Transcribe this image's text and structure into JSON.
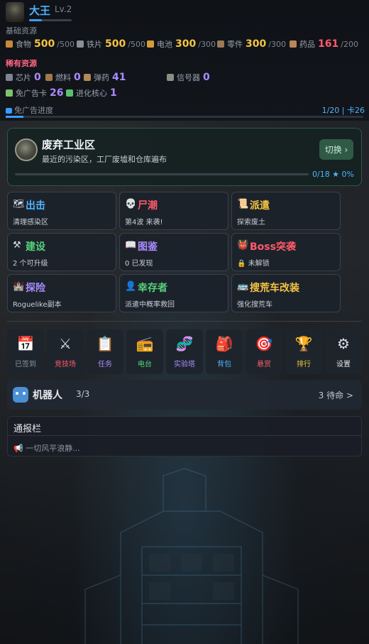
{
  "player": {
    "name": "大王",
    "level": "Lv.2",
    "xp_fraction": 0.3
  },
  "basic_resources": {
    "label": "基础资源",
    "items": [
      {
        "label": "食物",
        "value": "500",
        "max": "/500",
        "color": "gold",
        "icon": "food-icon"
      },
      {
        "label": "铁片",
        "value": "500",
        "max": "/500",
        "color": "gold",
        "icon": "iron-icon"
      },
      {
        "label": "电池",
        "value": "300",
        "max": "/300",
        "color": "gold",
        "icon": "battery-icon"
      },
      {
        "label": "零件",
        "value": "300",
        "max": "/300",
        "color": "gold",
        "icon": "parts-icon"
      },
      {
        "label": "药品",
        "value": "161",
        "max": "/200",
        "color": "red",
        "icon": "medicine-icon"
      }
    ]
  },
  "rare_resources": {
    "label": "稀有资源",
    "items": [
      {
        "label": "芯片",
        "value": "0"
      },
      {
        "label": "燃料",
        "value": "0"
      },
      {
        "label": "弹药",
        "value": "41"
      },
      {
        "label": "信号器",
        "value": "0"
      }
    ],
    "items2": [
      {
        "label": "免广告卡",
        "value": "26"
      },
      {
        "label": "进化核心",
        "value": "1"
      }
    ]
  },
  "ad_progress": {
    "label": "免广告进度",
    "value": "1/20 | 卡26",
    "fraction": 0.05
  },
  "area": {
    "title": "废弃工业区",
    "subtitle": "最近的污染区，工厂废墟和仓库遍布",
    "switch_label": "切换 ›",
    "progress": "0/18 ★  0%",
    "fraction": 0
  },
  "tiles": [
    {
      "icon": "🗺",
      "title": "出击",
      "sub": "清理感染区",
      "color": "#4fb3ff",
      "name": "attack"
    },
    {
      "icon": "💀",
      "title": "尸潮",
      "sub": "第4波 来袭!",
      "color": "#ff5a6a",
      "name": "zombie-wave"
    },
    {
      "icon": "📜",
      "title": "派遣",
      "sub": "探索废土",
      "color": "#f5c442",
      "name": "dispatch"
    },
    {
      "icon": "⚒",
      "title": "建设",
      "sub": "2 个可升级",
      "color": "#55d27a",
      "name": "build"
    },
    {
      "icon": "📖",
      "title": "图鉴",
      "sub": "0 已发现",
      "color": "#a98cff",
      "name": "codex"
    },
    {
      "icon": "👹",
      "title": "Boss突袭",
      "sub": "🔒 未解锁",
      "color": "#ff5a6a",
      "name": "boss-raid"
    },
    {
      "icon": "🏰",
      "title": "探险",
      "sub": "Roguelike副本",
      "color": "#a98cff",
      "name": "adventure"
    },
    {
      "icon": "👤",
      "title": "幸存者",
      "sub": "派遣中概率救回",
      "color": "#55d27a",
      "name": "survivors"
    },
    {
      "icon": "🚌",
      "title": "搜荒车改装",
      "sub": "强化搜荒车",
      "color": "#f5c442",
      "name": "vehicle-mod"
    }
  ],
  "icon_bar": [
    {
      "glyph": "📅",
      "label": "已签到",
      "color": "#8d949e",
      "name": "checkin"
    },
    {
      "glyph": "⚔",
      "label": "竞技场",
      "color": "#ff5a6a",
      "name": "arena"
    },
    {
      "glyph": "📋",
      "label": "任务",
      "color": "#a98cff",
      "name": "tasks"
    },
    {
      "glyph": "📻",
      "label": "电台",
      "color": "#55d27a",
      "name": "radio"
    },
    {
      "glyph": "🧬",
      "label": "实验塔",
      "color": "#a98cff",
      "name": "lab-tower"
    },
    {
      "glyph": "🎒",
      "label": "背包",
      "color": "#4fb3ff",
      "name": "backpack"
    },
    {
      "glyph": "🎯",
      "label": "悬赏",
      "color": "#ff5a6a",
      "name": "bounty"
    },
    {
      "glyph": "🏆",
      "label": "排行",
      "color": "#f5c442",
      "name": "ranking"
    },
    {
      "glyph": "⚙",
      "label": "设置",
      "color": "#e5e9ee",
      "name": "settings"
    }
  ],
  "robot": {
    "title": "机器人",
    "count": "3/3",
    "right": "3 待命 >"
  },
  "notice": {
    "title": "通报栏",
    "message": "📢 一切风平浪静..."
  },
  "colors": {
    "accent": "#4fb3ff",
    "gold": "#f5c442",
    "red": "#ff5a6a",
    "purple": "#a98cff",
    "green": "#55d27a"
  }
}
